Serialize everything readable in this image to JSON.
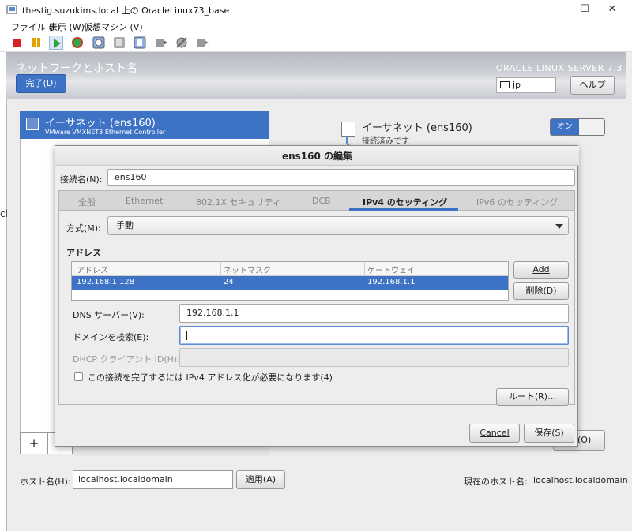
{
  "window": {
    "title": "thestig.suzukims.local 上の OracleLinux73_base",
    "minimize": "—",
    "maximize": "☐",
    "close": "✕"
  },
  "menubar": {
    "items": [
      "ファイル (F)",
      "表示 (W)",
      "仮想マシン (V)"
    ]
  },
  "toolbar": {
    "icons": [
      "stop-icon",
      "pause-icon",
      "play-icon",
      "reset-icon",
      "snapshot-icon",
      "snapshot-manager-icon",
      "revert-icon",
      "console-icon",
      "settings-icon",
      "tools-icon"
    ]
  },
  "header": {
    "title": "ネットワークとホスト名",
    "done_label": "完了(D)",
    "brand": "ORACLE LINUX SERVER 7.3",
    "keyboard_layout": "jp",
    "help_label": "ヘルプ"
  },
  "device_list": {
    "selected_name": "イーサネット (ens160)",
    "selected_desc": "VMware VMXNET3 Ethernet Controller",
    "add_label": "+"
  },
  "device_detail": {
    "title": "イーサネット (ens160)",
    "status": "接続済みです",
    "toggle_label": "オン",
    "partial_button": "(O)"
  },
  "hostname": {
    "label": "ホスト名(H):",
    "value": "localhost.localdomain",
    "apply_label": "適用(A)",
    "current_label": "現在のホスト名:",
    "current_value": "localhost.localdomain"
  },
  "cut_text": "cl",
  "dialog": {
    "title": "ens160 の編集",
    "conn_name_label": "接続名(N):",
    "conn_name_value": "ens160",
    "tabs": [
      "全般",
      "Ethernet",
      "802.1X セキュリティ",
      "DCB",
      "IPv4 のセッティング",
      "IPv6 のセッティング"
    ],
    "active_tab": "IPv4 のセッティング",
    "method_label": "方式(M):",
    "method_value": "手動",
    "address_section": "アドレス",
    "table": {
      "headers": [
        "アドレス",
        "ネットマスク",
        "ゲートウェイ"
      ],
      "rows": [
        [
          "192.168.1.128",
          "24",
          "192.168.1.1"
        ]
      ]
    },
    "add_label": "Add",
    "delete_label": "削除(D)",
    "dns_label": "DNS サーバー(V):",
    "dns_value": "192.168.1.1",
    "search_label": "ドメインを検索(E):",
    "search_value": "",
    "dhcp_label": "DHCP クライアント ID(H):",
    "dhcp_value": "",
    "require_ipv4_label": "この接続を完了するには IPv4 アドレス化が必要になります(4)",
    "routes_label": "ルート(R)…",
    "cancel_label": "Cancel",
    "save_label": "保存(S)"
  },
  "colors": {
    "accent": "#3d72c4",
    "dialog_bg": "#ededed"
  }
}
